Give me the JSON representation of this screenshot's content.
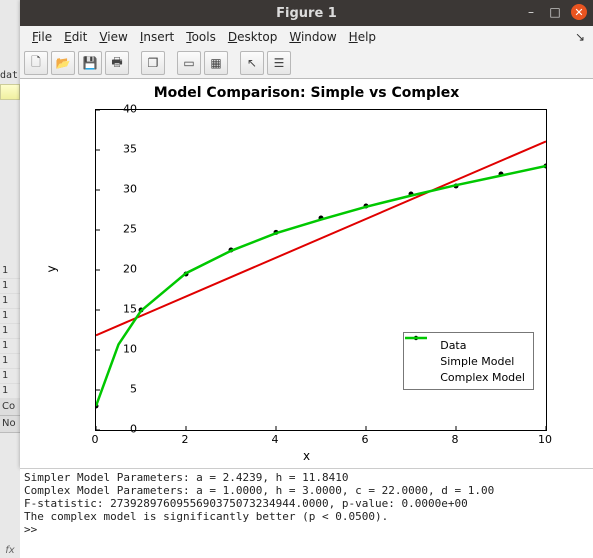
{
  "window": {
    "title": "Figure 1",
    "controls": {
      "min": "–",
      "max": "□",
      "close": "✕"
    }
  },
  "menubar": {
    "items": [
      {
        "label": "File",
        "u": 0
      },
      {
        "label": "Edit",
        "u": 0
      },
      {
        "label": "View",
        "u": 0
      },
      {
        "label": "Insert",
        "u": 0
      },
      {
        "label": "Tools",
        "u": 0
      },
      {
        "label": "Desktop",
        "u": 0
      },
      {
        "label": "Window",
        "u": 0
      },
      {
        "label": "Help",
        "u": 0
      }
    ],
    "arrow": "↘"
  },
  "toolbar": {
    "icons": [
      "new",
      "open",
      "save",
      "print",
      "",
      "fig",
      "subplot",
      "",
      "tile",
      "grid",
      "",
      "pointer",
      "props"
    ]
  },
  "chart_data": {
    "type": "line",
    "title": "Model Comparison: Simple vs Complex",
    "xlabel": "x",
    "ylabel": "y",
    "xlim": [
      0,
      10
    ],
    "ylim": [
      0,
      40
    ],
    "xticks": [
      0,
      2,
      4,
      6,
      8,
      10
    ],
    "yticks": [
      0,
      5,
      10,
      15,
      20,
      25,
      30,
      35,
      40
    ],
    "series": [
      {
        "name": "Data",
        "style": "points",
        "color": "#000000",
        "x": [
          0,
          1,
          2,
          3,
          4,
          5,
          6,
          7,
          8,
          9,
          10
        ],
        "y": [
          3.0,
          15.0,
          19.5,
          22.5,
          24.7,
          26.5,
          28.0,
          29.5,
          30.5,
          32.0,
          33.0
        ]
      },
      {
        "name": "Simple Model",
        "style": "line",
        "color": "#e00000",
        "x": [
          0,
          10
        ],
        "y": [
          11.84,
          36.08
        ]
      },
      {
        "name": "Complex Model",
        "style": "line",
        "color": "#00c800",
        "x": [
          0,
          0.5,
          1,
          2,
          3,
          4,
          5,
          6,
          7,
          8,
          9,
          10
        ],
        "y": [
          3.0,
          10.7,
          14.9,
          19.6,
          22.4,
          24.6,
          26.3,
          27.9,
          29.3,
          30.6,
          31.8,
          33.0
        ]
      }
    ],
    "legend": {
      "position": "lower right",
      "entries": [
        "Data",
        "Simple Model",
        "Complex Model"
      ]
    }
  },
  "console": {
    "lines": [
      "Simpler Model Parameters: a = 2.4239, h = 11.8410",
      "Complex Model Parameters: a = 1.0000, h = 3.0000, c = 22.0000, d = 1.00",
      "F-statistic: 27392897609556903750732349​44.0000, p-value: 0.0000e+00",
      "The complex model is significantly better (p < 0.0500).",
      ">>"
    ]
  },
  "left_strip": {
    "dat": "dat",
    "ones": [
      "1",
      "1",
      "1",
      "1",
      "1",
      "1",
      "1",
      "1",
      "1"
    ],
    "tabs": [
      "Co",
      "No"
    ],
    "fx": "fx"
  }
}
